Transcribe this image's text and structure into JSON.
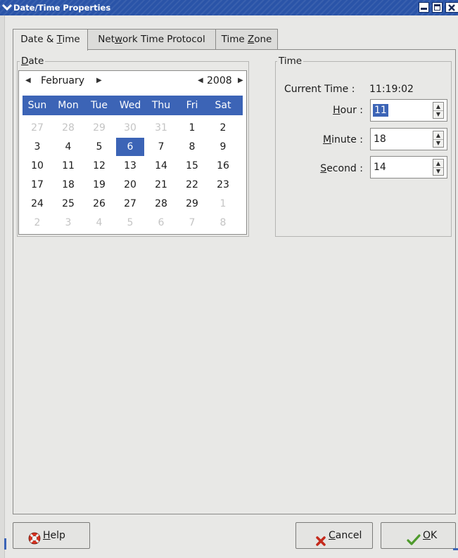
{
  "window": {
    "title": "Date/Time Properties",
    "controls": {
      "minimize_icon": "minimize-icon",
      "maximize_icon": "maximize-icon",
      "close_icon": "close-icon"
    }
  },
  "tabs": [
    {
      "pre": "Date & ",
      "mn": "T",
      "post": "ime",
      "active": true
    },
    {
      "pre": "Net",
      "mn": "w",
      "post": "ork Time Protocol",
      "active": false
    },
    {
      "pre": "Time ",
      "mn": "Z",
      "post": "one",
      "active": false
    }
  ],
  "date": {
    "frame_label_mn": "D",
    "frame_label_rest": "ate",
    "month": "February",
    "year": "2008",
    "weekdays": [
      "Sun",
      "Mon",
      "Tue",
      "Wed",
      "Thu",
      "Fri",
      "Sat"
    ],
    "weeks": [
      [
        "27",
        "28",
        "29",
        "30",
        "31",
        "1",
        "2"
      ],
      [
        "3",
        "4",
        "5",
        "6",
        "7",
        "8",
        "9"
      ],
      [
        "10",
        "11",
        "12",
        "13",
        "14",
        "15",
        "16"
      ],
      [
        "17",
        "18",
        "19",
        "20",
        "21",
        "22",
        "23"
      ],
      [
        "24",
        "25",
        "26",
        "27",
        "28",
        "29",
        "1"
      ],
      [
        "2",
        "3",
        "4",
        "5",
        "6",
        "7",
        "8"
      ]
    ],
    "selected_day": "6",
    "accent_color": "#3c64b6"
  },
  "time": {
    "frame_label": "Time",
    "current_label": "Current Time :",
    "current_value": "11:19:02",
    "hour": {
      "mn": "H",
      "rest": "our :",
      "value": "11"
    },
    "minute": {
      "mn": "M",
      "rest": "inute :",
      "value": "18"
    },
    "second": {
      "mn": "S",
      "rest": "econd :",
      "value": "14"
    }
  },
  "buttons": {
    "help": {
      "mn": "H",
      "rest": "elp",
      "icon": "lifebuoy-icon"
    },
    "cancel": {
      "mn": "C",
      "rest": "ancel",
      "icon": "x-icon"
    },
    "ok": {
      "mn": "O",
      "rest": "K",
      "icon": "checkmark-icon"
    }
  }
}
